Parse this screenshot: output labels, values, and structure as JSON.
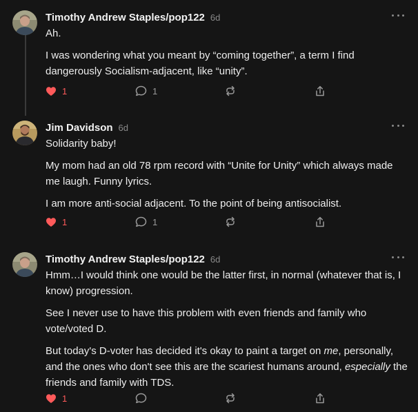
{
  "comments": [
    {
      "author": "Timothy Andrew Staples/pop122",
      "time": "6d",
      "paragraphs": [
        [
          "Ah."
        ],
        [
          "I was wondering what you meant by “coming together”, a term I find dangerously Socialism-adjacent, like “unity”."
        ]
      ],
      "likes": "1",
      "replies": "1"
    },
    {
      "author": "Jim Davidson",
      "time": "6d",
      "paragraphs": [
        [
          "Solidarity baby!"
        ],
        [
          "My mom had an old 78 rpm record with “Unite for Unity” which always made me laugh. Funny lyrics."
        ],
        [
          "I am more anti-social adjacent. To the point of being antisocialist."
        ]
      ],
      "likes": "1",
      "replies": "1"
    },
    {
      "author": "Timothy Andrew Staples/pop122",
      "time": "6d",
      "paragraphs": [
        [
          "Hmm…I would think one would be the latter first, in normal (whatever that is, I know) progression."
        ],
        [
          "See I never use to have this problem with even friends and family who vote/voted D."
        ],
        [
          "But today's D-voter has decided it's okay to paint a target on ",
          "me",
          ", personally, and the ones who don't see this are the scariest humans around, ",
          "especially",
          " the friends and family with TDS."
        ]
      ],
      "likes": "1",
      "replies": ""
    }
  ],
  "colors": {
    "background": "#151515",
    "like_active": "#ff5a5a",
    "muted": "#8a8a8a",
    "text": "#ededed"
  },
  "icons": {
    "like": "heart-icon",
    "reply": "speech-bubble-icon",
    "restack": "restack-icon",
    "share": "share-icon",
    "more": "more-horizontal-icon"
  }
}
